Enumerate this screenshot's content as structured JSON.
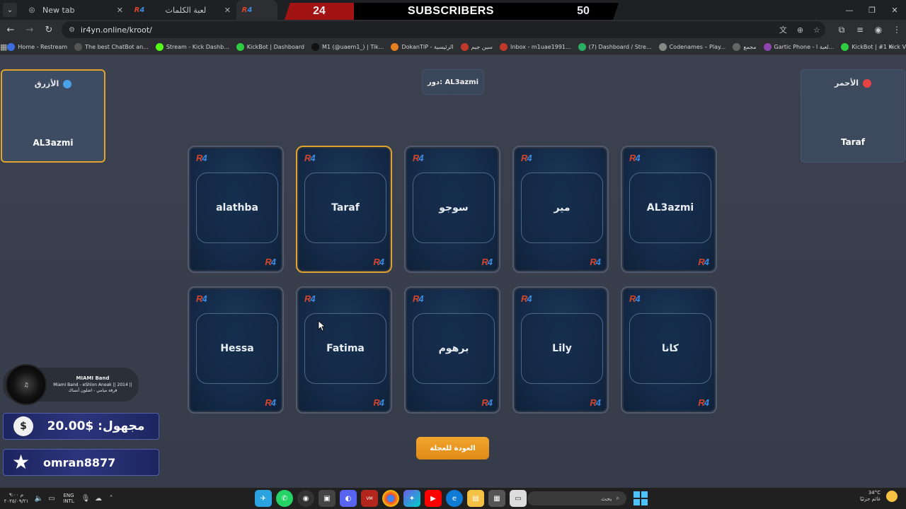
{
  "browser": {
    "tabs": [
      {
        "title": "New tab",
        "active": false
      },
      {
        "title": "لعبة الكلمات",
        "active": false
      },
      {
        "title": "",
        "active": true
      }
    ],
    "url": "ir4yn.online/kroot/",
    "bookmarks": [
      {
        "label": "Home - Restream",
        "color": "#3d6ee0"
      },
      {
        "label": "The best ChatBot an...",
        "color": "#555"
      },
      {
        "label": "Stream - Kick Dashb...",
        "color": "#53fc18"
      },
      {
        "label": "KickBot | Dashboard",
        "color": "#2ecc40"
      },
      {
        "label": "M1 (@uaem1_) | Tik...",
        "color": "#111"
      },
      {
        "label": "DokanTIP - الرئيسية",
        "color": "#e67e22"
      },
      {
        "label": "سين جيم",
        "color": "#c0392b"
      },
      {
        "label": "Inbox - m1uae1991...",
        "color": "#c0392b"
      },
      {
        "label": "(7) Dashboard / Stre...",
        "color": "#27ae60"
      },
      {
        "label": "Codenames – Play...",
        "color": "#888"
      },
      {
        "label": "مجمع",
        "color": "#666"
      },
      {
        "label": "Gartic Phone - لعبة ا...",
        "color": "#8e44ad"
      },
      {
        "label": "KickBot | #1 Kick Vie...",
        "color": "#2ecc40"
      }
    ]
  },
  "subscribers": {
    "left": "24",
    "label": "SUBSCRIBERS",
    "right": "50"
  },
  "game": {
    "blue_team": {
      "name": "الأزرق",
      "member": "AL3azmi"
    },
    "red_team": {
      "name": "الأحمر",
      "member": "Taraf"
    },
    "turn": "دور: AL3azmi",
    "card_logo": {
      "r": "R",
      "four": "4"
    },
    "cards": [
      {
        "label": "alathba",
        "selected": false
      },
      {
        "label": "Taraf",
        "selected": true
      },
      {
        "label": "سوجو",
        "selected": false
      },
      {
        "label": "مير",
        "selected": false
      },
      {
        "label": "AL3azmi",
        "selected": false
      },
      {
        "label": "Hessa",
        "selected": false
      },
      {
        "label": "Fatima",
        "selected": false
      },
      {
        "label": "برهوم",
        "selected": false
      },
      {
        "label": "Lily",
        "selected": false
      },
      {
        "label": "كانا",
        "selected": false
      }
    ],
    "back_button": "العودة للعجلة"
  },
  "overlays": {
    "music": {
      "title": "MIAMI Band",
      "subtitle": "Miami Band - eShlon Aneak || 2014 ||",
      "subtitle2": "فرقة ميامي - اشلون أنساك"
    },
    "donation": {
      "value": "مجهول: $20.00"
    },
    "follower": {
      "name": "omran8877"
    }
  },
  "taskbar": {
    "date": "٢٠٢٥/٠٩/٢١",
    "time": "م ٩:٠٠",
    "lang": "ENG",
    "lang2": "INTL",
    "search": "بحث",
    "temp": "34°C",
    "weather": "غائم جزئيًا"
  },
  "colors": {
    "accent": "#e0a42c",
    "blue": "#4aa3e8",
    "red": "#e84343",
    "button": "#f0a52e"
  }
}
